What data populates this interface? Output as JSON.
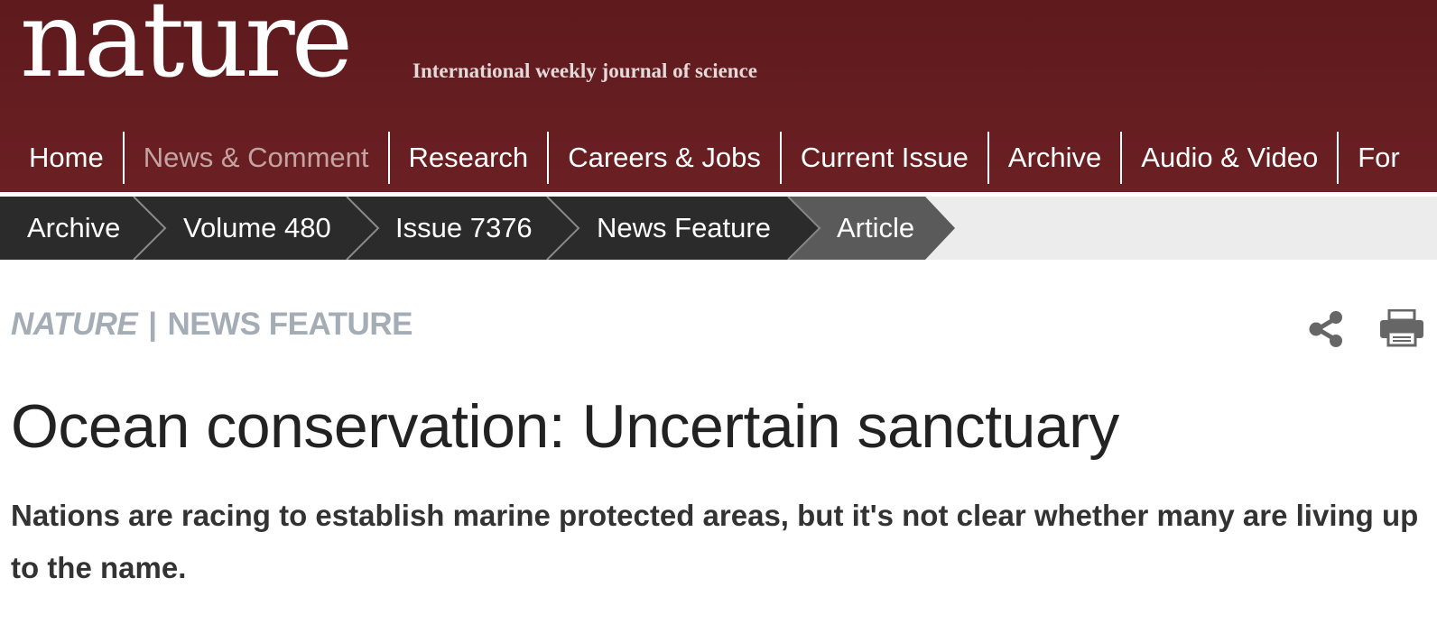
{
  "masthead": {
    "logo_text": "nature",
    "tagline": "International weekly journal of science"
  },
  "main_nav": {
    "items": [
      {
        "label": "Home"
      },
      {
        "label": "News & Comment",
        "active": true
      },
      {
        "label": "Research"
      },
      {
        "label": "Careers & Jobs"
      },
      {
        "label": "Current Issue"
      },
      {
        "label": "Archive"
      },
      {
        "label": "Audio & Video"
      },
      {
        "label": "For"
      }
    ]
  },
  "breadcrumb": {
    "items": [
      {
        "label": "Archive"
      },
      {
        "label": "Volume 480"
      },
      {
        "label": "Issue 7376"
      },
      {
        "label": "News Feature"
      },
      {
        "label": "Article",
        "current": true
      }
    ]
  },
  "article": {
    "journal": "NATURE",
    "separator": "|",
    "section": "NEWS FEATURE",
    "title": "Ocean conservation: Uncertain sanctuary",
    "standfirst": "Nations are racing to establish marine protected areas, but it's not clear whether many are living up to the name."
  },
  "tools": {
    "share_icon": "share-icon",
    "print_icon": "print-icon"
  },
  "colors": {
    "masthead": "#6b2023",
    "breadcrumb_dark": "#2b2b2b",
    "breadcrumb_current": "#5a5a5a",
    "kicker": "#a4acb5",
    "inactive_nav": "#c4a3a3"
  }
}
